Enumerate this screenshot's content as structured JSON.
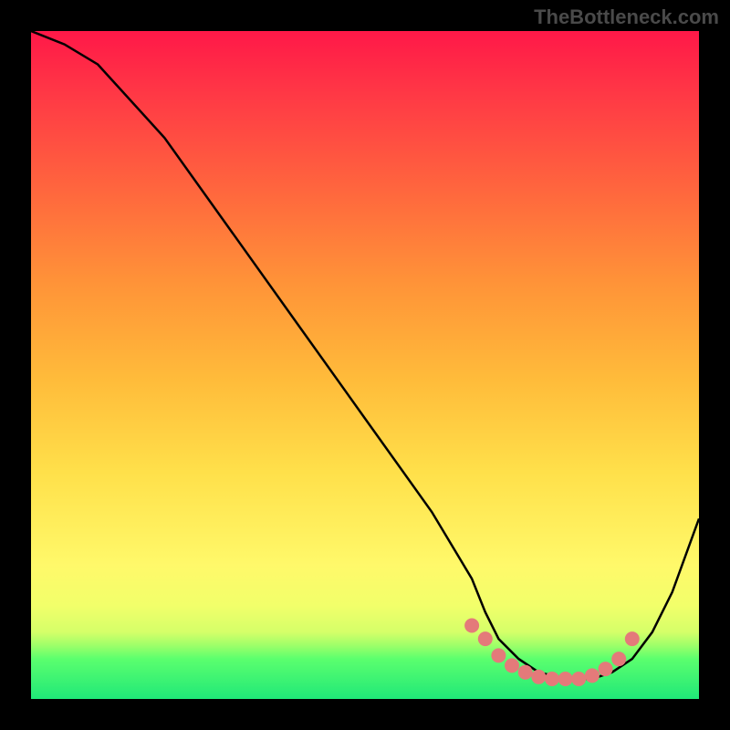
{
  "watermark": "TheBottleneck.com",
  "chart_data": {
    "type": "line",
    "title": "",
    "xlabel": "",
    "ylabel": "",
    "xlim": [
      0,
      100
    ],
    "ylim": [
      0,
      100
    ],
    "series": [
      {
        "name": "bottleneck-curve",
        "x": [
          0,
          5,
          10,
          20,
          30,
          40,
          50,
          60,
          66,
          68,
          70,
          73,
          76,
          80,
          84,
          87,
          90,
          93,
          96,
          100
        ],
        "y": [
          100,
          98,
          95,
          84,
          70,
          56,
          42,
          28,
          18,
          13,
          9,
          6,
          4,
          3,
          3,
          4,
          6,
          10,
          16,
          27
        ]
      }
    ],
    "markers": {
      "name": "highlight-dots",
      "color": "#e47a7a",
      "points": [
        {
          "x": 66,
          "y": 11
        },
        {
          "x": 68,
          "y": 9
        },
        {
          "x": 70,
          "y": 6.5
        },
        {
          "x": 72,
          "y": 5
        },
        {
          "x": 74,
          "y": 4
        },
        {
          "x": 76,
          "y": 3.3
        },
        {
          "x": 78,
          "y": 3
        },
        {
          "x": 80,
          "y": 3
        },
        {
          "x": 82,
          "y": 3
        },
        {
          "x": 84,
          "y": 3.5
        },
        {
          "x": 86,
          "y": 4.5
        },
        {
          "x": 88,
          "y": 6
        },
        {
          "x": 90,
          "y": 9
        }
      ]
    },
    "gradient_stops": [
      {
        "pos": 0,
        "color": "#ff1848"
      },
      {
        "pos": 10,
        "color": "#ff3a45"
      },
      {
        "pos": 25,
        "color": "#ff6a3d"
      },
      {
        "pos": 38,
        "color": "#ff9438"
      },
      {
        "pos": 52,
        "color": "#ffbb3a"
      },
      {
        "pos": 66,
        "color": "#ffe04a"
      },
      {
        "pos": 80,
        "color": "#fff96a"
      },
      {
        "pos": 86,
        "color": "#f2ff6a"
      },
      {
        "pos": 90,
        "color": "#d5ff69"
      },
      {
        "pos": 92,
        "color": "#9dff69"
      },
      {
        "pos": 94,
        "color": "#5bff6e"
      },
      {
        "pos": 100,
        "color": "#20e878"
      }
    ],
    "marker_color": "#e47a7a",
    "curve_color": "#000000"
  }
}
